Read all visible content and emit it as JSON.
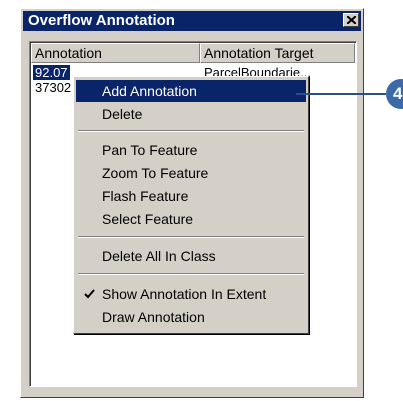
{
  "window": {
    "title": "Overflow Annotation"
  },
  "list": {
    "columns": [
      "Annotation",
      "Annotation Target"
    ],
    "rows": [
      {
        "annotation": "92.07",
        "target": "ParcelBoundarie..."
      },
      {
        "annotation": "37302",
        "target": ""
      }
    ]
  },
  "context_menu": {
    "items": [
      "Add Annotation",
      "Delete",
      "Pan To Feature",
      "Zoom To Feature",
      "Flash Feature",
      "Select Feature",
      "Delete All In Class",
      "Show Annotation In Extent",
      "Draw Annotation"
    ],
    "highlighted_item": "Add Annotation",
    "checked_item": "Show Annotation In Extent"
  },
  "callout": {
    "number": "4"
  },
  "colors": {
    "titlebar": "#0a246a",
    "face": "#d4d0c8",
    "highlight": "#0a246a",
    "callout": "#3a6aa8"
  },
  "icons": [
    "close-icon",
    "check-icon"
  ]
}
